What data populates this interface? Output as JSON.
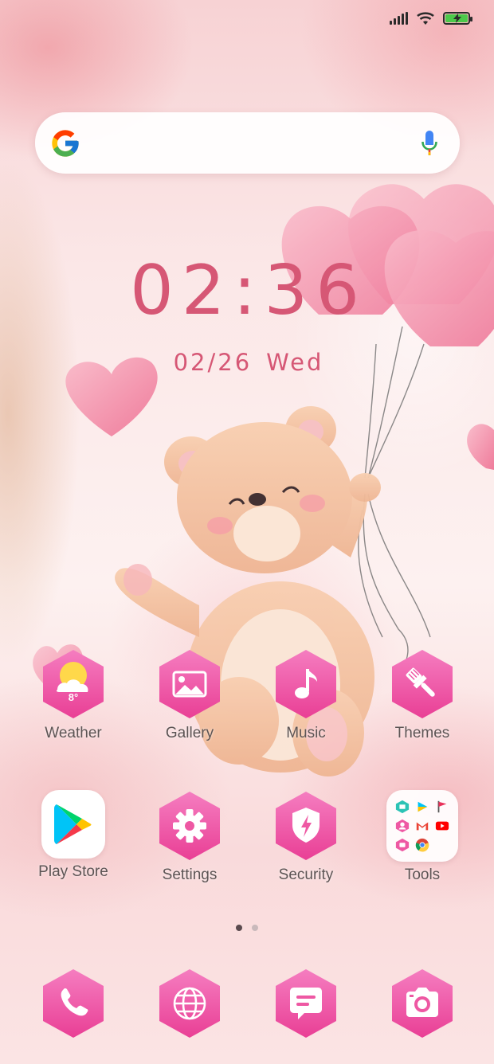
{
  "status_bar": {
    "icons": [
      "signal-icon",
      "wifi-icon",
      "battery-charging-icon"
    ],
    "battery_color": "#4cc94a"
  },
  "search": {
    "logo": "google-logo",
    "mic": "microphone-icon"
  },
  "clock": {
    "time": "02:36",
    "date": "02/26",
    "weekday": "Wed"
  },
  "apps": [
    {
      "label": "Weather",
      "icon": "weather-icon",
      "temp": "8°"
    },
    {
      "label": "Gallery",
      "icon": "gallery-icon"
    },
    {
      "label": "Music",
      "icon": "music-icon"
    },
    {
      "label": "Themes",
      "icon": "paintbrush-icon"
    },
    {
      "label": "Play Store",
      "icon": "play-store-icon"
    },
    {
      "label": "Settings",
      "icon": "gear-icon"
    },
    {
      "label": "Security",
      "icon": "shield-icon"
    },
    {
      "label": "Tools",
      "icon": "folder-icon"
    }
  ],
  "dock": [
    {
      "icon": "phone-icon"
    },
    {
      "icon": "globe-icon"
    },
    {
      "icon": "message-icon"
    },
    {
      "icon": "camera-icon"
    }
  ],
  "pages": {
    "count": 2,
    "current": 1
  },
  "theme": {
    "accent": "#d65775",
    "hexagon_top": "#f26fb5",
    "hexagon_bottom": "#e93f95"
  }
}
